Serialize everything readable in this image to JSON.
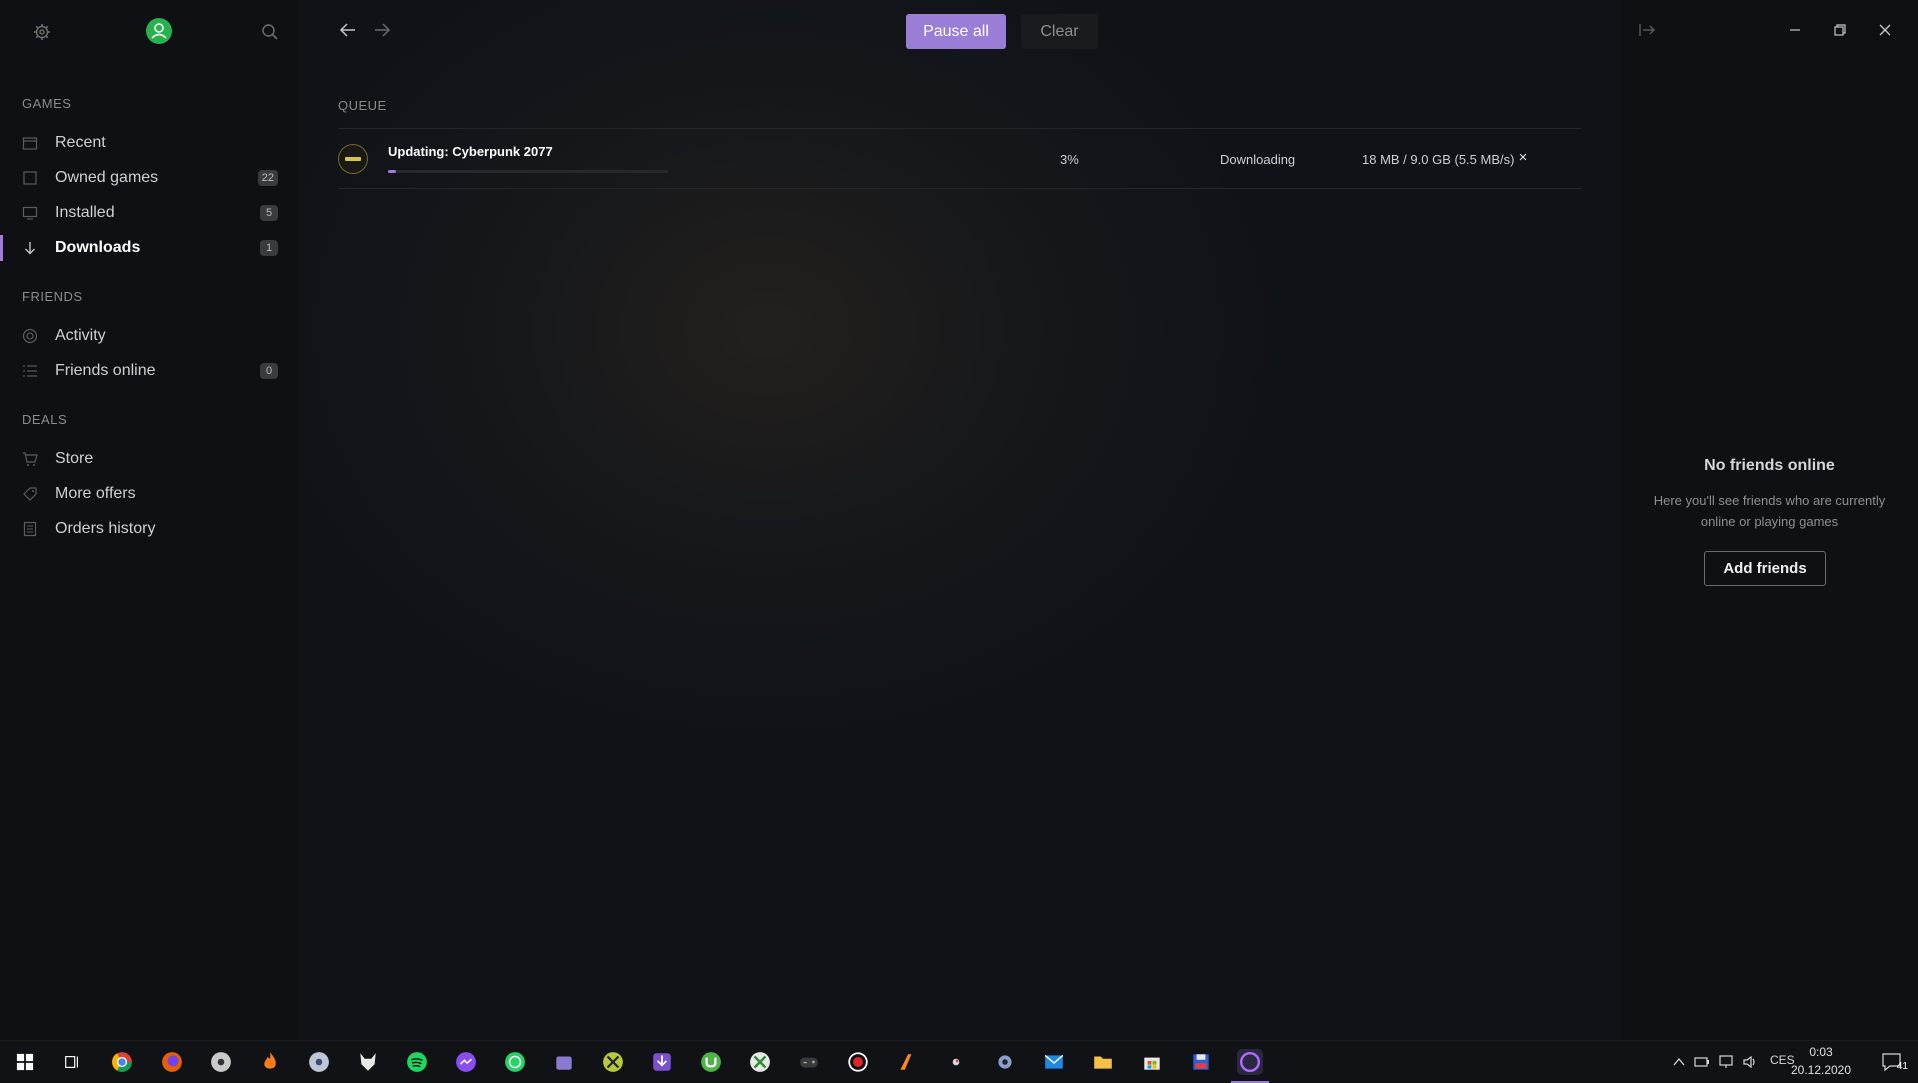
{
  "sidebar": {
    "sections": {
      "games": "GAMES",
      "friends": "FRIENDS",
      "deals": "DEALS"
    },
    "items": {
      "recent": {
        "label": "Recent",
        "icon": "calendar-icon"
      },
      "owned": {
        "label": "Owned games",
        "badge": "22",
        "icon": "square-icon"
      },
      "installed": {
        "label": "Installed",
        "badge": "5",
        "icon": "monitor-icon"
      },
      "downloads": {
        "label": "Downloads",
        "badge": "1",
        "icon": "arrow-down-icon"
      },
      "activity": {
        "label": "Activity",
        "icon": "target-icon"
      },
      "friends_online": {
        "label": "Friends online",
        "badge": "0",
        "icon": "list-icon"
      },
      "store": {
        "label": "Store",
        "icon": "cart-icon"
      },
      "more_offers": {
        "label": "More offers",
        "icon": "tag-icon"
      },
      "orders_history": {
        "label": "Orders history",
        "icon": "receipt-icon"
      }
    }
  },
  "toolbar": {
    "pause_all": "Pause all",
    "clear": "Clear"
  },
  "queue": {
    "label": "QUEUE",
    "rows": [
      {
        "title": "Updating: Cyberpunk 2077",
        "progress_pct": 3,
        "percent": "3%",
        "status": "Downloading",
        "size": "18 MB / 9.0 GB (5.5 MB/s)",
        "remove": "×"
      }
    ]
  },
  "right_panel": {
    "empty_title": "No friends online",
    "empty_desc": "Here you'll see friends who are currently online or playing games",
    "add_friends": "Add friends"
  },
  "taskbar": {
    "tray": {
      "language": "CES",
      "time": "0:03",
      "date": "20.12.2020",
      "notifications": "41"
    }
  },
  "colors": {
    "accent": "#9a7dd6",
    "avatar": "#26b24c",
    "background": "#0f1013"
  }
}
